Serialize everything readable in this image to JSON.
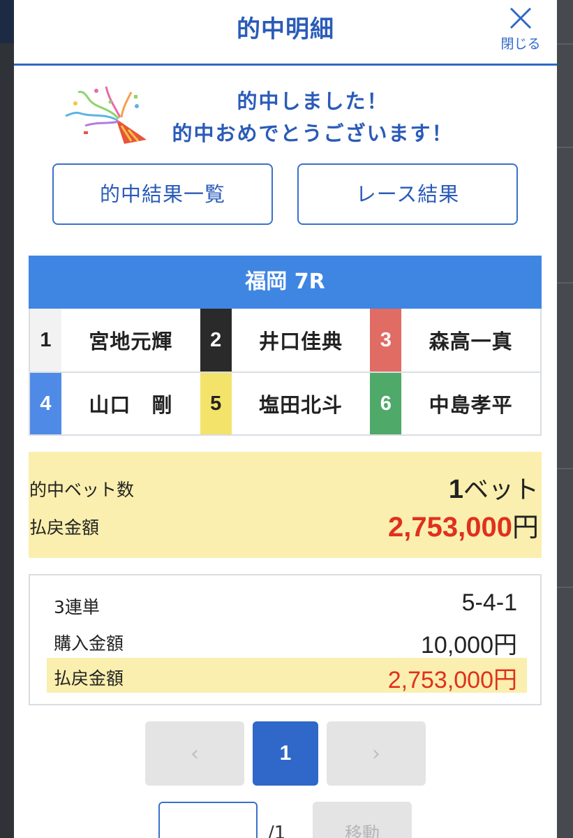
{
  "header": {
    "title": "的中明細",
    "close_label": "閉じる"
  },
  "congrats": {
    "line1": "的中しました！",
    "line2": "的中おめでとうございます！",
    "icon": "party-popper-icon"
  },
  "buttons": {
    "hit_list": "的中結果一覧",
    "race_result": "レース結果"
  },
  "race": {
    "title": "福岡 7R",
    "racers": [
      {
        "num": "1",
        "name": "宮地元輝",
        "bg": "#f2f2f2",
        "fg": "#222222"
      },
      {
        "num": "2",
        "name": "井口佳典",
        "bg": "#2a2a2a",
        "fg": "#ffffff"
      },
      {
        "num": "3",
        "name": "森高一真",
        "bg": "#e06c64",
        "fg": "#ffffff"
      },
      {
        "num": "4",
        "name": "山口　剛",
        "bg": "#4f8be6",
        "fg": "#ffffff"
      },
      {
        "num": "5",
        "name": "塩田北斗",
        "bg": "#f3e36a",
        "fg": "#222222"
      },
      {
        "num": "6",
        "name": "中島孝平",
        "bg": "#4fa968",
        "fg": "#ffffff"
      }
    ]
  },
  "summary": {
    "bets_label": "的中ベット数",
    "bets_value": "1",
    "bets_unit": "ベット",
    "payout_label": "払戻金額",
    "payout_value": "2,753,000",
    "payout_unit": "円"
  },
  "detail": {
    "bet_type": "3連単",
    "combination": "5-4-1",
    "purchase_label": "購入金額",
    "purchase_value": "10,000円",
    "payout_label": "払戻金額",
    "payout_value": "2,753,000円"
  },
  "pagination": {
    "prev": "‹",
    "current": "1",
    "next": "›",
    "total": "/1",
    "move_label": "移動",
    "input_value": ""
  },
  "colors": {
    "accent": "#2f68c8",
    "payout_red": "#e0301e",
    "highlight": "#faefae"
  }
}
